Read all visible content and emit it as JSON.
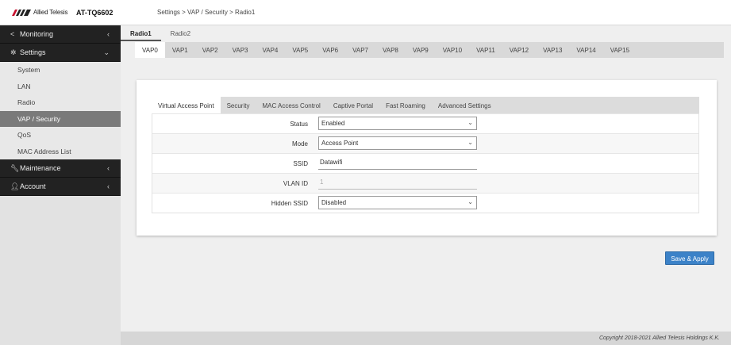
{
  "header": {
    "brand": "Allied Telesis",
    "model": "AT-TQ6602",
    "breadcrumb": "Settings > VAP / Security > Radio1"
  },
  "sidebar": {
    "groups": [
      {
        "label": "Monitoring",
        "icon": "share-icon",
        "arrow": "‹"
      },
      {
        "label": "Settings",
        "icon": "gear-icon",
        "arrow": "⌄"
      },
      {
        "label": "Maintenance",
        "icon": "wrench-icon",
        "arrow": "‹"
      },
      {
        "label": "Account",
        "icon": "user-icon",
        "arrow": "‹"
      }
    ],
    "items": [
      "System",
      "LAN",
      "Radio",
      "VAP / Security",
      "QoS",
      "MAC Address List"
    ],
    "active_item": "VAP / Security"
  },
  "radio_tabs": [
    "Radio1",
    "Radio2"
  ],
  "vap_tabs": [
    "VAP0",
    "VAP1",
    "VAP2",
    "VAP3",
    "VAP4",
    "VAP5",
    "VAP6",
    "VAP7",
    "VAP8",
    "VAP9",
    "VAP10",
    "VAP11",
    "VAP12",
    "VAP13",
    "VAP14",
    "VAP15"
  ],
  "sub_tabs": [
    "Virtual Access Point",
    "Security",
    "MAC Access Control",
    "Captive Portal",
    "Fast Roaming",
    "Advanced Settings"
  ],
  "form": {
    "status": {
      "label": "Status",
      "value": "Enabled"
    },
    "mode": {
      "label": "Mode",
      "value": "Access Point"
    },
    "ssid": {
      "label": "SSID",
      "value": "Dataw​ifi"
    },
    "vlan_id": {
      "label": "VLAN ID",
      "value": "1"
    },
    "hidden_ssid": {
      "label": "Hidden SSID",
      "value": "Disabled"
    }
  },
  "save_button": "Save & Apply",
  "footer": {
    "copyright": "Copyright 2018-2021 Allied Telesis Holdings K.K."
  },
  "colors": {
    "accent": "#3c82c8",
    "sidebar_dark": "#222222",
    "active_item": "#7a7a7a"
  }
}
